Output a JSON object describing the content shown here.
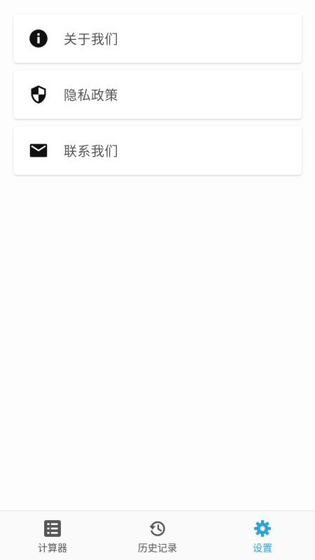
{
  "settings_list": {
    "items": [
      {
        "label": "关于我们",
        "icon": "info-icon"
      },
      {
        "label": "隐私政策",
        "icon": "shield-icon"
      },
      {
        "label": "联系我们",
        "icon": "mail-icon"
      }
    ]
  },
  "tab_bar": {
    "tabs": [
      {
        "label": "计算器",
        "icon": "calculator-icon",
        "active": false
      },
      {
        "label": "历史记录",
        "icon": "history-icon",
        "active": false
      },
      {
        "label": "设置",
        "icon": "gear-icon",
        "active": true
      }
    ],
    "active_color": "#29a3df",
    "inactive_color": "#555555"
  }
}
